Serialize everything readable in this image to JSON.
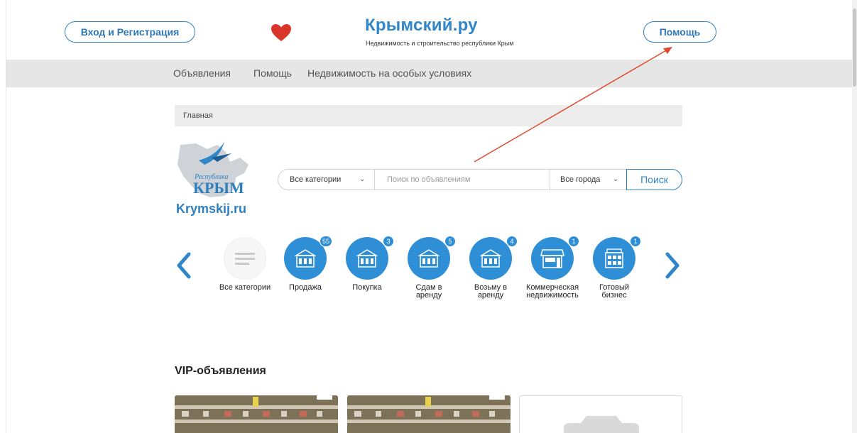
{
  "header": {
    "login_label": "Вход и Регистрация",
    "help_label": "Помощь",
    "site_title": "Крымский.ру",
    "site_subtitle": "Недвижимость и строительство республики Крым",
    "heart_icon": "heart-icon",
    "accent_color": "#2f86c8"
  },
  "nav": {
    "items": [
      {
        "label": "Объявления"
      },
      {
        "label": "Помощь"
      },
      {
        "label": "Недвижимость на особых условиях"
      }
    ]
  },
  "breadcrumb": {
    "label": "Главная"
  },
  "logo": {
    "republic_text": "Республика",
    "crimea_text": "КРЫМ",
    "site_text": "Krymskij.ru"
  },
  "search": {
    "category_label": "Все категории",
    "placeholder": "Поиск по объявлениям",
    "city_label": "Все города",
    "button_label": "Поиск"
  },
  "categories": [
    {
      "label": "Все категории",
      "badge": null,
      "icon": "list-icon"
    },
    {
      "label": "Продажа",
      "badge": "55",
      "icon": "building-icon"
    },
    {
      "label": "Покупка",
      "badge": "3",
      "icon": "building-icon"
    },
    {
      "label": "Сдам в аренду",
      "badge": "5",
      "icon": "building-icon"
    },
    {
      "label": "Возьму в аренду",
      "badge": "4",
      "icon": "building-icon"
    },
    {
      "label": "Коммерческая недвижимость",
      "badge": "1",
      "icon": "shop-icon"
    },
    {
      "label": "Готовый бизнес",
      "badge": "1",
      "icon": "hotel-icon"
    }
  ],
  "vip": {
    "title": "VIP-объявления"
  },
  "annotation": {
    "arrow_color": "#e04a2e"
  }
}
